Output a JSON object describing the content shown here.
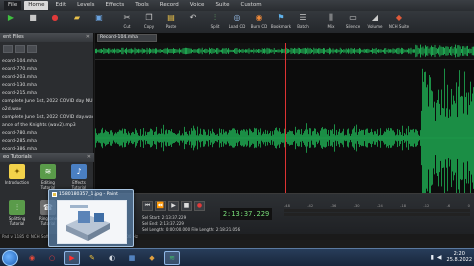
{
  "menu": {
    "items": [
      "File",
      "Home",
      "Edit",
      "Levels",
      "Effects",
      "Tools",
      "Record",
      "Voice",
      "Suite",
      "Custom"
    ]
  },
  "toolbar": {
    "buttons": [
      {
        "label": "",
        "icon": "play-icon"
      },
      {
        "label": "",
        "icon": "stop-icon"
      },
      {
        "label": "",
        "icon": "record-icon"
      },
      {
        "label": "",
        "icon": "open-icon"
      },
      {
        "label": "",
        "icon": "save-icon"
      },
      {
        "label": "Cut",
        "icon": "cut-icon"
      },
      {
        "label": "Copy",
        "icon": "copy-icon"
      },
      {
        "label": "Paste",
        "icon": "paste-icon"
      },
      {
        "label": "",
        "icon": "undo-icon"
      },
      {
        "label": "Split",
        "icon": "split-icon"
      },
      {
        "label": "Load CD",
        "icon": "load-cd-icon"
      },
      {
        "label": "Burn CD",
        "icon": "burn-cd-icon"
      },
      {
        "label": "Bookmark",
        "icon": "bookmark-icon"
      },
      {
        "label": "Batch",
        "icon": "batch-icon"
      },
      {
        "label": "Mix",
        "icon": "mix-icon"
      },
      {
        "label": "Silence",
        "icon": "silence-icon"
      },
      {
        "label": "Volume",
        "icon": "volume-icon"
      },
      {
        "label": "NCH Suite",
        "icon": "nch-suite-icon"
      }
    ]
  },
  "sidebar": {
    "files_title": "ent Files",
    "files": [
      "ecord-104.mha",
      "ecord-770.mha",
      "ecord-203.mha",
      "ecord-130.mha",
      "ecord-215.mha",
      "complete June 1st, 2022 COVID day NUMBER",
      "o2d.wav",
      "complete June 1st, 2022 COVID day.wav",
      "ance of the Knights (wav2).mp3",
      "ecord-780.mha",
      "ecord-285.mha",
      "ecord-386.mha"
    ],
    "tutorials_title": "eo Tutorials",
    "tutorials": [
      {
        "label": "Introduction",
        "icon": "lightbulb-icon"
      },
      {
        "label": "Editing Tutorial",
        "icon": "editing-icon"
      },
      {
        "label": "Effects Tutorial",
        "icon": "effects-icon"
      },
      {
        "label": "Splitting Tutorial",
        "icon": "splitting-icon"
      },
      {
        "label": "Ringtone Tutorial",
        "icon": "ringtone-icon"
      },
      {
        "label": "",
        "icon": "tutorial-icon"
      }
    ]
  },
  "editor": {
    "tab_label": "Record-104.mha",
    "ruler_ticks": [
      "2h:13m",
      "2h:13m:5",
      "2h:13m:10",
      "2h:13m:15",
      "2h:13m:20",
      "2h:13m:25",
      "2h:13m:30"
    ]
  },
  "transport": {
    "time": "2:13:37.229",
    "sel_start_label": "Sel Start:",
    "sel_start": "2:13:37.229",
    "sel_end_label": "Sel End:",
    "sel_end": "2:13:37.229",
    "sel_length_label": "Sel Length:",
    "sel_length": "0:00:00.000",
    "file_length_label": "File Length:",
    "file_length": "2:18:21.056",
    "level_scale": [
      "-48",
      "-42",
      "-36",
      "-30",
      "-24",
      "-18",
      "-12",
      "-6",
      "0"
    ],
    "status_left": "Pad v 1185 © NCH Soft",
    "status_mid": "ion: 16000 Hz"
  },
  "thumbnail": {
    "title": "1580180357_1.jpg - Paint"
  },
  "taskbar": {
    "clock_time": "2:20",
    "clock_date": "25.8.2022",
    "icons": [
      "start-orb",
      "chrome-icon",
      "opera-icon",
      "youtube-icon",
      "paint-icon",
      "app-icon",
      "app-icon-2",
      "app-icon-3",
      "wavepad-icon"
    ]
  },
  "colors": {
    "waveform": "#22c55e",
    "playhead": "#dd3333",
    "accent": "#d9d9d9"
  }
}
